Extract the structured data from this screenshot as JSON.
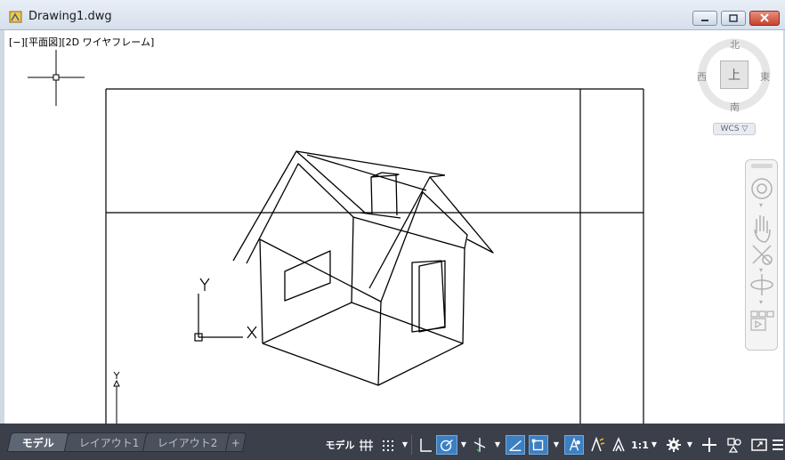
{
  "window": {
    "title": "Drawing1.dwg",
    "colors": {
      "titlebar": "#dce5f0",
      "close_button": "#c7422b",
      "viewport_bg": "#ffffff",
      "drawing_lines": "#000000"
    }
  },
  "viewport": {
    "label": "[−][平面図][2D ワイヤフレーム]"
  },
  "viewcube": {
    "north": "北",
    "south": "南",
    "east": "東",
    "west": "西",
    "face": "上",
    "coordinate_system": "WCS"
  },
  "ucs": {
    "x_axis": "X",
    "y_axis": "Y",
    "small_y_axis": "Y"
  },
  "navbar": {
    "icons": [
      "steering-wheel-icon",
      "pan-icon",
      "zoom-extents-icon",
      "orbit-icon",
      "showmotion-icon"
    ]
  },
  "tabs": [
    {
      "label": "モデル",
      "active": true
    },
    {
      "label": "レイアウト1",
      "active": false
    },
    {
      "label": "レイアウト2",
      "active": false
    },
    {
      "label": "+",
      "active": false
    }
  ],
  "statusbar": {
    "model_button": "モデル",
    "annotation_scale": "1:1",
    "toggles": {
      "grid": false,
      "snap": false,
      "ortho": false,
      "polar": true,
      "isodraft": false,
      "object_snap_tracking": true,
      "object_snap": true,
      "annotation_visibility": true
    }
  }
}
